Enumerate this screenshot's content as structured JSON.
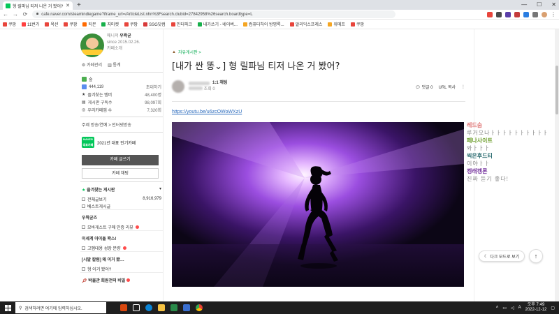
{
  "browser": {
    "tab_title": "형 릴파님 티저 나온 거 봤어?",
    "new_tab": "+",
    "url": "cafe.naver.com/steamindiegame?iframe_url=/ArticleList.nhn%3Fsearch.clubid=27842958%26search.boardtype=L",
    "bookmarks": [
      "쿠팡",
      "11번가",
      "옥션",
      "쿠팡",
      "티몬",
      "지마켓",
      "쿠팡",
      "SSG닷컴",
      "인터파크",
      "내가쓰기 - 네이버...",
      "컴퓨터하이 방명록...",
      "알리익스프레스",
      "위메프",
      "쿠팡"
    ]
  },
  "sidebar": {
    "owner_role": "매니저",
    "owner_name": "우왁굳",
    "since": "since 2015.02.26.",
    "invite": "카페소개",
    "admin_links": [
      "카페관리",
      "통계"
    ],
    "level_label": "숲",
    "members": "444,119",
    "invite_btn": "초대하기",
    "stats": [
      {
        "label": "즐겨찾는 멤버",
        "value": "48,400명"
      },
      {
        "label": "게시판 구독수",
        "value": "98,097회"
      },
      {
        "label": "우리카페앱 수",
        "value": "7,320회"
      }
    ],
    "fav_row": "주제 방송/연예 > 인터넷방송",
    "naver_badge": "NAVER 대표카페",
    "naver_text": "2021년 대표 인기카페",
    "write_btn": "카페 글쓰기",
    "chat_btn": "카페 채팅",
    "fav_boards_title": "즐겨찾는 게시판",
    "menu": [
      {
        "label": "전체글보기",
        "count": "8,916,979"
      },
      {
        "label": "베스트게시글",
        "count": ""
      }
    ],
    "group1": "우왁굳즈",
    "item1": "모바게스트 구매 인증 리뷰",
    "group2": "이세계 아이돌 왁스!",
    "item2": "고멤대용 성장 분량",
    "group3": "[시발 칼럼] 왜 이거 봤…",
    "item3": "형 이거 봤어?",
    "group4": "박물관 회원전의 비밀"
  },
  "article": {
    "board": "자유게시판 >",
    "title": "[내가 싼 똥⌄] 형 릴파님 티저 나온 거 봤어?",
    "chat_label": "1:1 채팅",
    "views": "조회 0",
    "comments": "댓글 0",
    "url_copy": "URL 복사",
    "youtube_link": "https://youtu.be/u6zcOWoWXzU"
  },
  "chat": [
    {
      "name": "레드숨",
      "color": "#e07a7a",
      "msg": "루거오나ㅏㅏㅏㅏㅏㅏㅏㅏㅏㅏ"
    },
    {
      "name": "페나사이트",
      "color": "#6f9f2f",
      "msg": "와ㅏㅏㅏ"
    },
    {
      "name": "씩은후드티",
      "color": "#2a6b70",
      "msg": "이야ㅏㅏ"
    },
    {
      "name": "켕래켕론",
      "color": "#7a3aa0",
      "msg": "진짜 듣기 좋다!"
    }
  ],
  "buttons": {
    "dark_mode": "다크 모드로 보기",
    "top": "↑"
  },
  "taskbar": {
    "search_placeholder": "검색하려면 여기에 입력하십시오.",
    "time": "오후 7:49",
    "date": "2022-12-12"
  },
  "colors": {
    "naver_green": "#03c75a",
    "link_blue": "#2b6bbd"
  }
}
